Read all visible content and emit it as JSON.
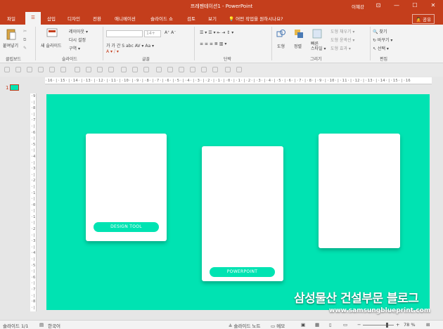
{
  "titlebar": {
    "title": "프레젠테이션1 - PowerPoint",
    "user": "이혜강",
    "min": "—",
    "max": "☐",
    "close": "✕",
    "ribbon_opts": "⊡"
  },
  "tabs": [
    {
      "label": "파일"
    },
    {
      "label": "☰"
    },
    {
      "label": "삽입"
    },
    {
      "label": "디자인"
    },
    {
      "label": "전환"
    },
    {
      "label": "애니메이션"
    },
    {
      "label": "슬라이드 쇼"
    },
    {
      "label": "검토"
    },
    {
      "label": "보기"
    }
  ],
  "tell_me": "💡 어떤 작업을 원하시나요?",
  "share": "🙎 공유",
  "ribbon": {
    "groups": {
      "clipboard": "클립보드",
      "slides": "슬라이드",
      "font": "글꼴",
      "paragraph": "단락",
      "drawing": "그리기",
      "editing": "편집"
    },
    "paste": "붙여넣기",
    "new_slide": "새 슬라이드",
    "layout": "레이아웃 ▾",
    "reset": "다시 설정",
    "section": "구역 ▾",
    "font_name": "",
    "font_size": "14+",
    "grow": "A⁺ A⁻",
    "format_row": "가 가 간 S abc AV ▾ Aa ▾",
    "color_row": "A ▾ ⧸ ▾",
    "para_row1": "☰ ▾ ☰ ▾ ⇤ ⇥ ↕ ▾",
    "para_row2": "≡ ≡ ≡ ≣ ▥ ▾",
    "shapes": "도형",
    "arrange": "정렬",
    "quick_styles": "빠른\n스타일 ▾",
    "fill": "도형 채우기 ▾",
    "outline": "도형 윤곽선 ▾",
    "effects": "도형 효과 ▾",
    "find": "🔍 찾기",
    "replace": "↻ 바꾸기 ▾",
    "select": "↖ 선택 ▾"
  },
  "rulers": {
    "horizontal": "·16·|·15·|·14·|·13·|·12·|·11·|·10·|·9·|·8·|·7·|·6·|·5·|·4·|·3·|·2·|·1·|·0·|·1·|·2·|·3·|·4·|·5·|·6·|·7·|·8·|·9·|·10·|·11·|·12·|·13·|·14·|·15·|·16",
    "vertical": "·9·|·8·|·7·|·6·|·5·|·4·|·3·|·2·|·1·|·0·|·1·|·2·|·3·|·4·|·5·|·6·|·7·|·8·|·9"
  },
  "thumbnail": {
    "number": "1"
  },
  "slide": {
    "background": "#00e3b2",
    "cards": [
      {
        "button": "DESIGN TOOL"
      },
      {
        "button": "POWERPOINT"
      },
      {
        "button": ""
      }
    ]
  },
  "watermark": {
    "main": "삼성물산 건설부문 블로그",
    "url": "www.samsungblueprint.com"
  },
  "status": {
    "slide_count": "슬라이드 1/1",
    "language": "한국어",
    "notes": "≜ 슬라이드 노트",
    "comments": "▭ 메모",
    "zoom": "78 %",
    "zoom_level": 0.78,
    "zoom_minus": "−",
    "zoom_plus": "+"
  },
  "colors": {
    "accent": "#c43e1c",
    "slide_bg": "#00e3b2",
    "card": "#ffffff"
  }
}
